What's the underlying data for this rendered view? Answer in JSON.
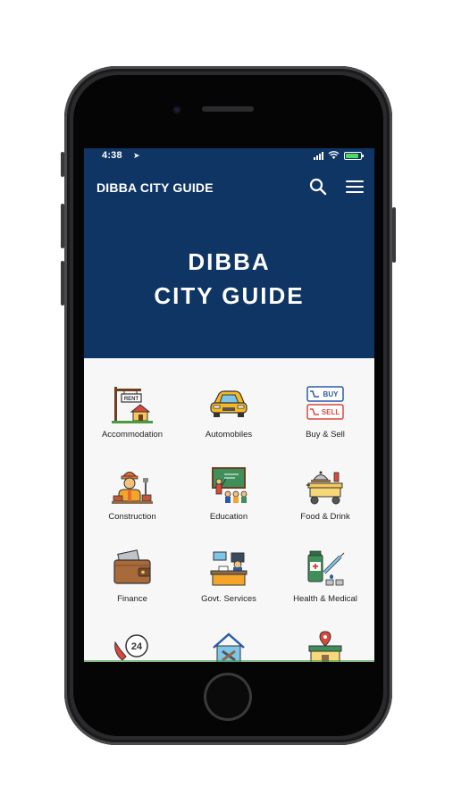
{
  "status_bar": {
    "time": "4:38",
    "location_arrow": "➤"
  },
  "app_bar": {
    "title": "DIBBA CITY GUIDE",
    "search_icon": "search-icon",
    "menu_icon": "hamburger-menu-icon"
  },
  "hero": {
    "line1": "DIBBA",
    "line2": "CITY GUIDE"
  },
  "categories": [
    {
      "label": "Accommodation",
      "icon": "rent-house-icon"
    },
    {
      "label": "Automobiles",
      "icon": "car-icon"
    },
    {
      "label": "Buy & Sell",
      "icon": "buy-sell-icon"
    },
    {
      "label": "Construction",
      "icon": "construction-worker-icon"
    },
    {
      "label": "Education",
      "icon": "classroom-icon"
    },
    {
      "label": "Food & Drink",
      "icon": "food-cart-icon"
    },
    {
      "label": "Finance",
      "icon": "wallet-icon"
    },
    {
      "label": "Govt. Services",
      "icon": "government-desk-icon"
    },
    {
      "label": "Health & Medical",
      "icon": "medicine-syringe-icon"
    },
    {
      "label": "",
      "icon": "phone-24-icon"
    },
    {
      "label": "",
      "icon": "home-repair-icon"
    },
    {
      "label": "",
      "icon": "store-location-icon"
    }
  ],
  "colors": {
    "header": "#0f3564",
    "background": "#f7f7f7",
    "battery": "#4cd964"
  },
  "text_values": {
    "buy": "BUY",
    "sell": "SELL",
    "rent": "RENT",
    "hours": "24"
  }
}
